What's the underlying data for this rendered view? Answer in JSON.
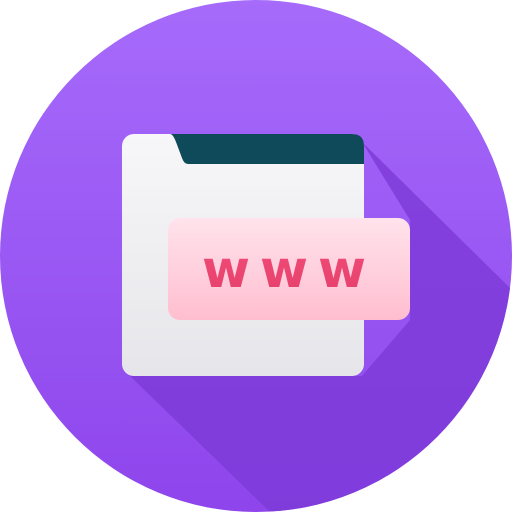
{
  "icon": {
    "name": "www-browser-window-icon",
    "label": "www",
    "colors": {
      "circle_top": "#A66BFB",
      "circle_bottom": "#8E45EC",
      "shadow": "#7A37D3",
      "window": "#F2F2F4",
      "window_edge": "#E4E4E8",
      "title_bar": "#0E4A5A",
      "url_pill_top": "#FFE0EA",
      "url_pill_bottom": "#FFC0D2",
      "url_text": "#F05078"
    }
  }
}
